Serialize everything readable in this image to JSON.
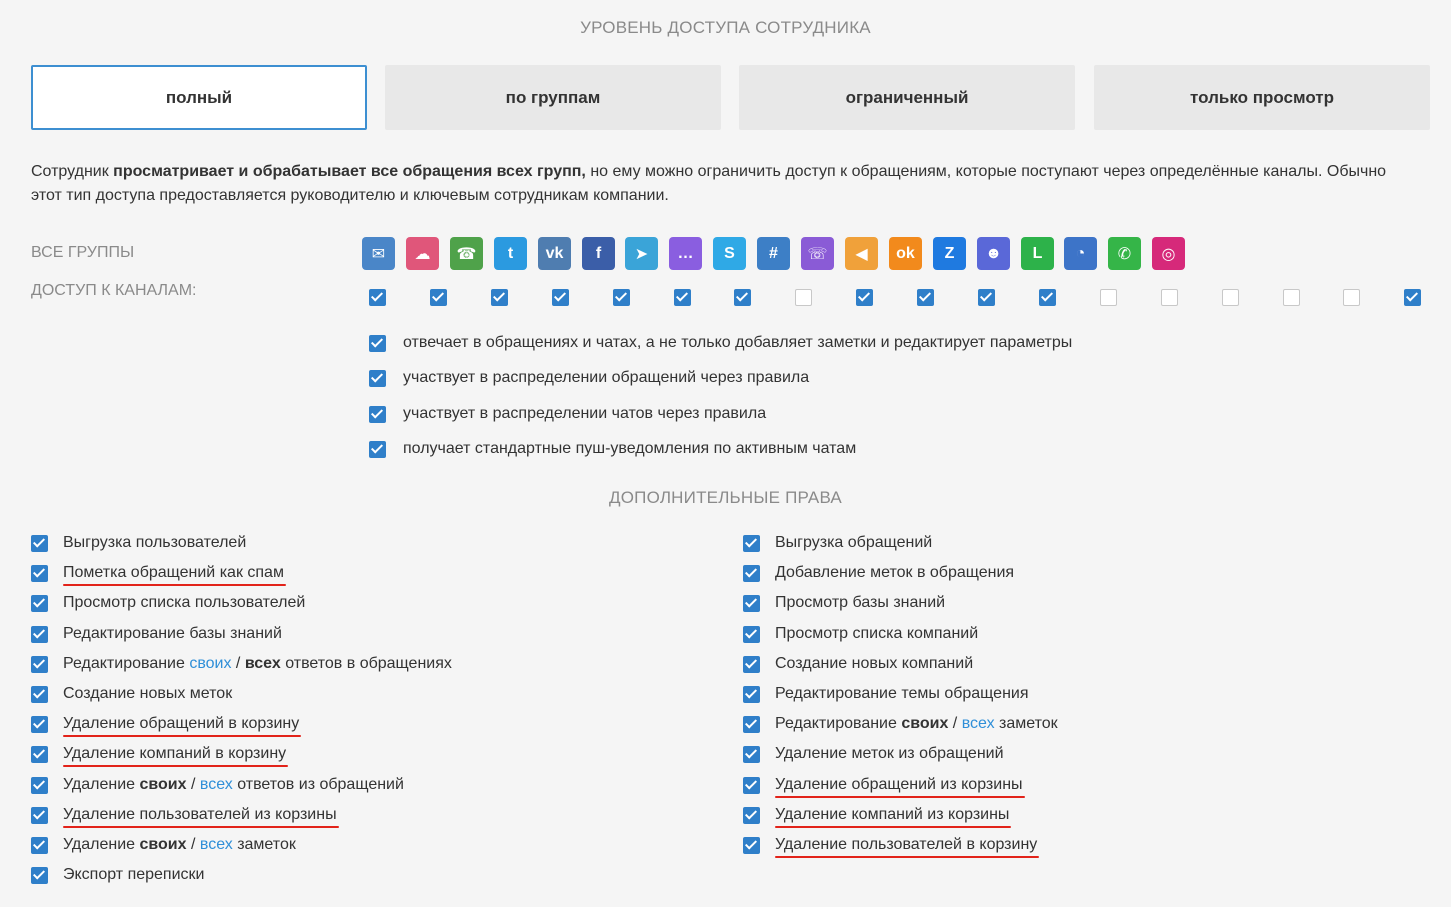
{
  "title_access": "УРОВЕНЬ ДОСТУПА СОТРУДНИКА",
  "tabs": [
    {
      "label": "полный",
      "active": true
    },
    {
      "label": "по группам",
      "active": false
    },
    {
      "label": "ограниченный",
      "active": false
    },
    {
      "label": "только просмотр",
      "active": false
    }
  ],
  "description": {
    "prefix": "Сотрудник ",
    "bold": "просматривает и обрабатывает все обращения всех групп,",
    "suffix": " но ему можно ограничить доступ к обращениям, которые поступают через определённые каналы. Обычно этот тип доступа предоставляется руководителю и ключевым сотрудникам компании."
  },
  "label_groups": "ВСЕ ГРУППЫ",
  "label_channels": "ДОСТУП К КАНАЛАМ:",
  "channels": [
    {
      "icon": "email-icon",
      "color": "#4a86c8",
      "glyph": "✉",
      "checked": true
    },
    {
      "icon": "chat-icon",
      "color": "#e0567a",
      "glyph": "☁",
      "checked": true
    },
    {
      "icon": "phone-icon",
      "color": "#4fa24a",
      "glyph": "☎",
      "checked": true
    },
    {
      "icon": "twitter-icon",
      "color": "#2b9ae0",
      "glyph": "t",
      "checked": true
    },
    {
      "icon": "vk-icon",
      "color": "#4f7db0",
      "glyph": "vk",
      "checked": true
    },
    {
      "icon": "facebook-icon",
      "color": "#3b5ea8",
      "glyph": "f",
      "checked": true
    },
    {
      "icon": "telegram-icon",
      "color": "#3aa4d8",
      "glyph": "➤",
      "checked": true
    },
    {
      "icon": "messenger-icon",
      "color": "#8a5ee0",
      "glyph": "…",
      "checked": false
    },
    {
      "icon": "skype-icon",
      "color": "#2fa9e6",
      "glyph": "S",
      "checked": true
    },
    {
      "icon": "slack-icon",
      "color": "#3d7fc6",
      "glyph": "#",
      "checked": true
    },
    {
      "icon": "viber-icon",
      "color": "#8a5bd6",
      "glyph": "☏",
      "checked": true
    },
    {
      "icon": "megaphone-icon",
      "color": "#f0a13a",
      "glyph": "◀",
      "checked": true
    },
    {
      "icon": "odnoklassniki-icon",
      "color": "#f28a1c",
      "glyph": "ok",
      "checked": false
    },
    {
      "icon": "zalo-icon",
      "color": "#1f7ae0",
      "glyph": "Z",
      "checked": false
    },
    {
      "icon": "team-icon",
      "color": "#5a68d8",
      "glyph": "☻",
      "checked": false
    },
    {
      "icon": "line-icon",
      "color": "#2db24a",
      "glyph": "L",
      "checked": false
    },
    {
      "icon": "widget-icon",
      "color": "#3d74c8",
      "glyph": "◔",
      "checked": false
    },
    {
      "icon": "whatsapp-icon",
      "color": "#35b548",
      "glyph": "✆",
      "checked": true
    },
    {
      "icon": "instagram-icon",
      "color": "#d6297a",
      "glyph": "◎",
      "checked": true
    }
  ],
  "options": [
    {
      "label": "отвечает в обращениях и чатах, а не только добавляет заметки и редактирует параметры",
      "checked": true
    },
    {
      "label": "участвует в распределении обращений через правила",
      "checked": true
    },
    {
      "label": "участвует в распределении чатов через правила",
      "checked": true
    },
    {
      "label": "получает стандартные пуш-уведомления по активным чатам",
      "checked": true
    }
  ],
  "title_extra": "ДОПОЛНИТЕЛЬНЫЕ ПРАВА",
  "perms_left": [
    {
      "parts": [
        {
          "t": "Выгрузка пользователей"
        }
      ],
      "underline": false
    },
    {
      "parts": [
        {
          "t": "Пометка обращений как спам"
        }
      ],
      "underline": true
    },
    {
      "parts": [
        {
          "t": "Просмотр списка пользователей"
        }
      ],
      "underline": false
    },
    {
      "parts": [
        {
          "t": "Редактирование базы знаний"
        }
      ],
      "underline": false
    },
    {
      "parts": [
        {
          "t": "Редактирование "
        },
        {
          "t": "своих",
          "s": "blue"
        },
        {
          "t": " / "
        },
        {
          "t": "всех",
          "s": "bold"
        },
        {
          "t": " ответов в обращениях"
        }
      ],
      "underline": false
    },
    {
      "parts": [
        {
          "t": "Создание новых меток"
        }
      ],
      "underline": false
    },
    {
      "parts": [
        {
          "t": "Удаление обращений в корзину"
        }
      ],
      "underline": true
    },
    {
      "parts": [
        {
          "t": "Удаление компаний в корзину"
        }
      ],
      "underline": true
    },
    {
      "parts": [
        {
          "t": "Удаление "
        },
        {
          "t": "своих",
          "s": "bold"
        },
        {
          "t": " / "
        },
        {
          "t": "всех",
          "s": "blue"
        },
        {
          "t": " ответов из обращений"
        }
      ],
      "underline": false
    },
    {
      "parts": [
        {
          "t": "Удаление пользователей из корзины"
        }
      ],
      "underline": true
    },
    {
      "parts": [
        {
          "t": "Удаление "
        },
        {
          "t": "своих",
          "s": "bold"
        },
        {
          "t": " / "
        },
        {
          "t": "всех",
          "s": "blue"
        },
        {
          "t": " заметок"
        }
      ],
      "underline": false
    },
    {
      "parts": [
        {
          "t": "Экспорт переписки"
        }
      ],
      "underline": false
    }
  ],
  "perms_right": [
    {
      "parts": [
        {
          "t": "Выгрузка обращений"
        }
      ],
      "underline": false
    },
    {
      "parts": [
        {
          "t": "Добавление меток в обращения"
        }
      ],
      "underline": false
    },
    {
      "parts": [
        {
          "t": "Просмотр базы знаний"
        }
      ],
      "underline": false
    },
    {
      "parts": [
        {
          "t": "Просмотр списка компаний"
        }
      ],
      "underline": false
    },
    {
      "parts": [
        {
          "t": "Создание новых компаний"
        }
      ],
      "underline": false
    },
    {
      "parts": [
        {
          "t": "Редактирование темы обращения"
        }
      ],
      "underline": false
    },
    {
      "parts": [
        {
          "t": "Редактирование "
        },
        {
          "t": "своих",
          "s": "bold"
        },
        {
          "t": " / "
        },
        {
          "t": "всех",
          "s": "blue"
        },
        {
          "t": " заметок"
        }
      ],
      "underline": false
    },
    {
      "parts": [
        {
          "t": "Удаление меток из обращений"
        }
      ],
      "underline": false
    },
    {
      "parts": [
        {
          "t": "Удаление обращений из корзины"
        }
      ],
      "underline": true
    },
    {
      "parts": [
        {
          "t": "Удаление компаний из корзины"
        }
      ],
      "underline": true
    },
    {
      "parts": [
        {
          "t": "Удаление пользователей в корзину"
        }
      ],
      "underline": true
    }
  ]
}
